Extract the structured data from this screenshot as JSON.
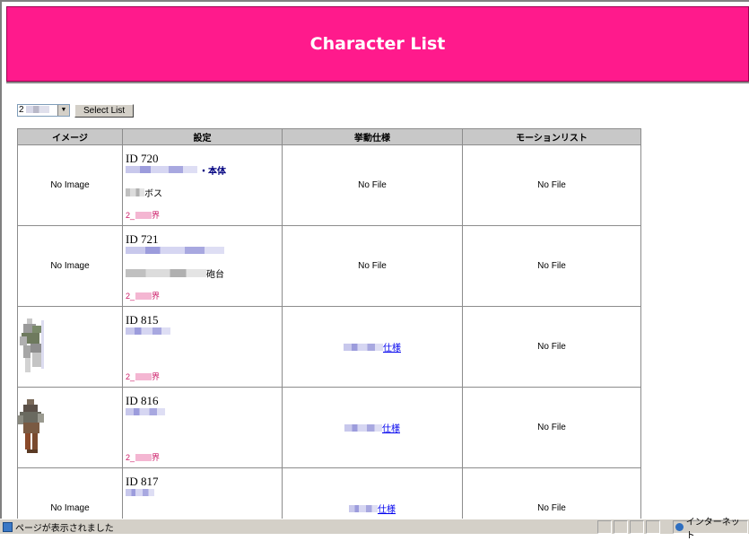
{
  "page": {
    "title": "Character List"
  },
  "controls": {
    "select_value": "2",
    "button_label": "Select List"
  },
  "table": {
    "headers": [
      "イメージ",
      "設定",
      "挙動仕様",
      "モーションリスト"
    ],
    "rows": [
      {
        "image": "No Image",
        "id": "ID 720",
        "name_suffix": "・本体",
        "sub_suffix": "ボス",
        "world": "2_",
        "world_suffix": "界",
        "behavior": "No File",
        "motion": "No File"
      },
      {
        "image": "No Image",
        "id": "ID 721",
        "name_suffix": "",
        "sub_suffix": "砲台",
        "world": "2_",
        "world_suffix": "界",
        "behavior": "No File",
        "motion": "No File"
      },
      {
        "image": "",
        "id": "ID 815",
        "name_suffix": "",
        "sub_suffix": "",
        "world": "2_",
        "world_suffix": "界",
        "behavior": "仕様",
        "motion": "No File"
      },
      {
        "image": "",
        "id": "ID 816",
        "name_suffix": "",
        "sub_suffix": "",
        "world": "2_",
        "world_suffix": "界",
        "behavior": "仕様",
        "motion": "No File"
      },
      {
        "image": "No Image",
        "id": "ID 817",
        "name_suffix": "",
        "sub_suffix": "",
        "world": "",
        "world_suffix": "",
        "behavior": "仕様",
        "motion": "No File"
      }
    ]
  },
  "statusbar": {
    "text": "ページが表示されました",
    "zone": "インターネット"
  },
  "colors": {
    "banner": "#ff1a8c",
    "header_bg": "#c8c8c8",
    "link": "#0000ee",
    "world": "#cc1a66"
  }
}
